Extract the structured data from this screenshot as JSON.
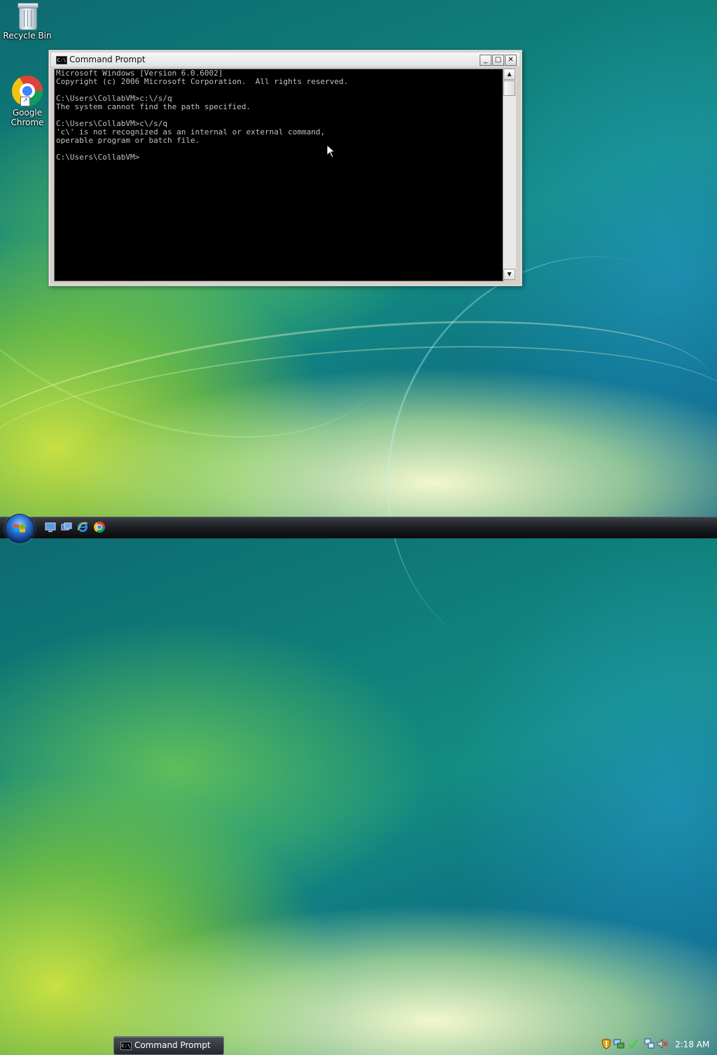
{
  "desktop": {
    "icons": [
      {
        "label": "Recycle Bin",
        "icon": "recycle-bin-icon"
      },
      {
        "label": "Google Chrome",
        "line1": "Google",
        "line2": "Chrome",
        "icon": "chrome-icon"
      }
    ]
  },
  "cmd_window": {
    "title": "Command Prompt",
    "buttons": {
      "minimize": "_",
      "maximize": "□",
      "close": "✕"
    },
    "lines": [
      "Microsoft Windows [Version 6.0.6002]",
      "Copyright (c) 2006 Microsoft Corporation.  All rights reserved.",
      "",
      "C:\\Users\\CollabVM>c:\\/s/q",
      "The system cannot find the path specified.",
      "",
      "C:\\Users\\CollabVM>c\\/s/q",
      "'c\\' is not recognized as an internal or external command,",
      "operable program or batch file.",
      "",
      "C:\\Users\\CollabVM>"
    ]
  },
  "taskbar": {
    "tasks": [
      {
        "label": "Command Prompt",
        "icon": "cmd-icon"
      }
    ],
    "quick_launch": [
      "show-desktop-icon",
      "switch-windows-icon",
      "internet-explorer-icon",
      "chrome-icon"
    ],
    "tray_icons": [
      "security-shield-icon",
      "network-icon",
      "update-check-icon",
      "network-connection-icon",
      "volume-muted-icon"
    ],
    "clock": "2:18 AM"
  },
  "colors": {
    "console_bg": "#000000",
    "console_fg": "#c0c0c0",
    "taskbar": "#1d2024"
  }
}
